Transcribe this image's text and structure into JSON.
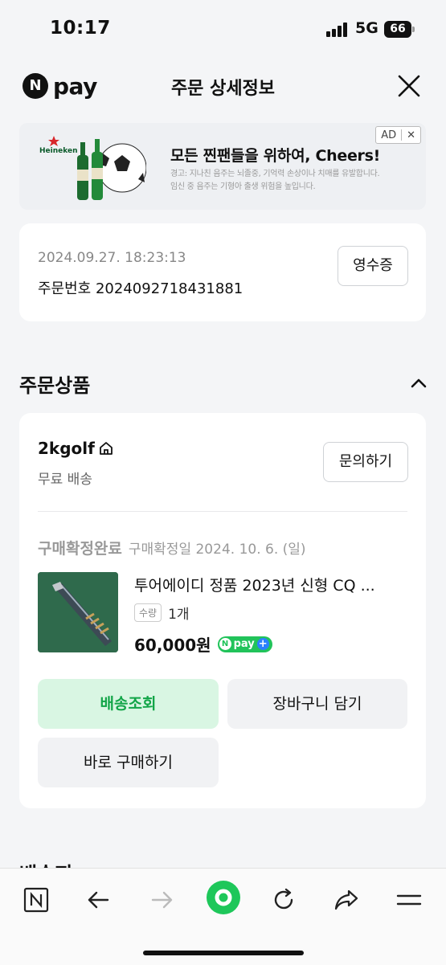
{
  "status_bar": {
    "time": "10:17",
    "network": "5G",
    "battery": "66"
  },
  "header": {
    "brand_mark": "N",
    "brand_text": "pay",
    "title": "주문 상세정보"
  },
  "ad": {
    "brand": "Heineken",
    "headline": "모든 찐팬들을 위하여, Cheers!",
    "fine_print_1": "경고: 지나친 음주는 뇌졸중, 기억력 손상이나 치매를 유발합니다.",
    "fine_print_2": "임신 중 음주는 기형아 출생 위험을 높입니다.",
    "badge": "AD",
    "close": "✕"
  },
  "order": {
    "date": "2024.09.27. 18:23:13",
    "number_label": "주문번호",
    "number": "2024092718431881",
    "receipt_button": "영수증"
  },
  "section": {
    "title": "주문상품"
  },
  "product": {
    "store": "2kgolf",
    "shipping": "무료 배송",
    "inquiry_button": "문의하기",
    "status": "구매확정완료",
    "status_detail": "구매확정일 2024. 10. 6. (일)",
    "name": "투어에이디 정품 2023년 신형 CQ ...",
    "qty_label": "수량",
    "qty": "1개",
    "price": "60,000원",
    "npay_plus": {
      "n": "N",
      "text": "pay",
      "plus": "+"
    },
    "track_button": "배송조회",
    "cart_button": "장바구니 담기",
    "buy_button": "바로 구매하기"
  },
  "next_section": {
    "title": "배송지"
  },
  "colors": {
    "accent_green": "#12a548",
    "light_green": "#d9f6e3",
    "npay_green": "#21c35a"
  },
  "bottom_nav": {
    "icons": [
      "naver-n-icon",
      "back-arrow-icon",
      "forward-arrow-icon",
      "home-circle-icon",
      "reload-icon",
      "share-icon",
      "menu-icon"
    ]
  }
}
